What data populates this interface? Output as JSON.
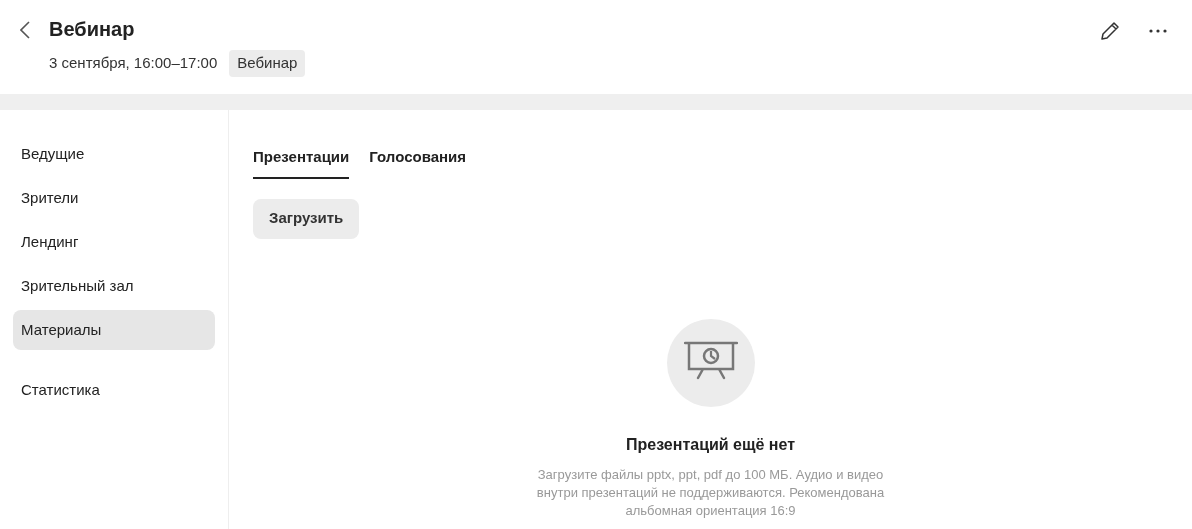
{
  "header": {
    "title": "Вебинар",
    "date": "3 сентября, 16:00–17:00",
    "badge": "Вебинар"
  },
  "sidebar": {
    "sections": [
      {
        "items": [
          {
            "label": "Ведущие",
            "selected": false
          },
          {
            "label": "Зрители",
            "selected": false
          },
          {
            "label": "Лендинг",
            "selected": false
          },
          {
            "label": "Зрительный зал",
            "selected": false
          },
          {
            "label": "Материалы",
            "selected": true
          }
        ]
      },
      {
        "items": [
          {
            "label": "Статистика",
            "selected": false
          }
        ]
      }
    ]
  },
  "tabs": [
    {
      "label": "Презентации",
      "selected": true
    },
    {
      "label": "Голосования",
      "selected": false
    }
  ],
  "upload_button": "Загрузить",
  "empty_state": {
    "title": "Презентаций ещё нет",
    "description": "Загрузите файлы pptx, ppt, pdf до 100 МБ. Аудио и видео внутри презентаций не поддерживаются. Рекомендована альбомная ориентация 16:9"
  }
}
